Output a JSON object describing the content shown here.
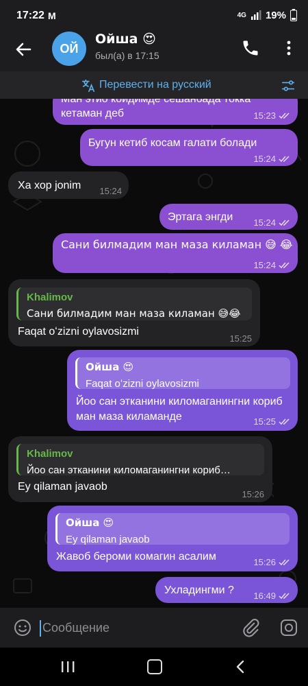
{
  "status_bar": {
    "time": "17:22",
    "gmail_icon": "M",
    "network": "4G",
    "battery": "19%"
  },
  "header": {
    "avatar_initials": "ОЙ",
    "contact_name": "Ойша 😍",
    "last_seen": "был(а) в 17:15"
  },
  "translate_bar": {
    "label": "Перевести на русский"
  },
  "messages": [
    {
      "id": "m1",
      "dir": "out",
      "text": "Ман этио койдимде сешанбада токка кетаман деб",
      "time": "15:23"
    },
    {
      "id": "m2",
      "dir": "out",
      "text": "Бугун кетиб косам галати болади",
      "time": "15:24"
    },
    {
      "id": "m3",
      "dir": "in",
      "text": "Ха хор jonim",
      "time": "15:24"
    },
    {
      "id": "m4",
      "dir": "out",
      "text": "Эртага энгди",
      "time": "15:24"
    },
    {
      "id": "m5",
      "dir": "out",
      "text": "Сани билмадим ман маза киламан 😅 😂",
      "time": "15:24"
    },
    {
      "id": "m6",
      "dir": "in",
      "quote_name": "Khalimov",
      "quote_text": "Сани билмадим ман маза киламан 😅😂",
      "text": "Faqat oʻzizni oylavosizmi",
      "time": "15:25"
    },
    {
      "id": "m7",
      "dir": "out",
      "quote_name": "Ойша 😍",
      "quote_text": "Faqat oʻzizni oylavosizmi",
      "text": "Йоо сан этканини киломаганингни кориб ман маза киламанде",
      "time": "15:25"
    },
    {
      "id": "m8",
      "dir": "in",
      "quote_name": "Khalimov",
      "quote_text": "Йоо сан этканини киломаганингни кориб…",
      "text": "Ey qilaman javaob",
      "time": "15:26"
    },
    {
      "id": "m9",
      "dir": "out",
      "quote_name": "Ойша 😍",
      "quote_text": "Ey qilaman javaob",
      "text": "Жавоб бероми комагин асалим",
      "time": "15:26"
    },
    {
      "id": "m10",
      "dir": "out",
      "text": "Ухладингми ?",
      "time": "16:49"
    }
  ],
  "composer": {
    "placeholder": "Сообщение"
  },
  "colors": {
    "outgoing": "#8b4fd1",
    "incoming": "#232325",
    "accent": "#5fb0ec",
    "quote_green": "#67b84a"
  },
  "icons": [
    "back-arrow-icon",
    "phone-icon",
    "more-vert-icon",
    "translate-icon",
    "filter-icon",
    "emoji-icon",
    "attach-icon",
    "camera-icon",
    "double-check-icon",
    "recents-icon",
    "home-icon",
    "nav-back-icon"
  ]
}
